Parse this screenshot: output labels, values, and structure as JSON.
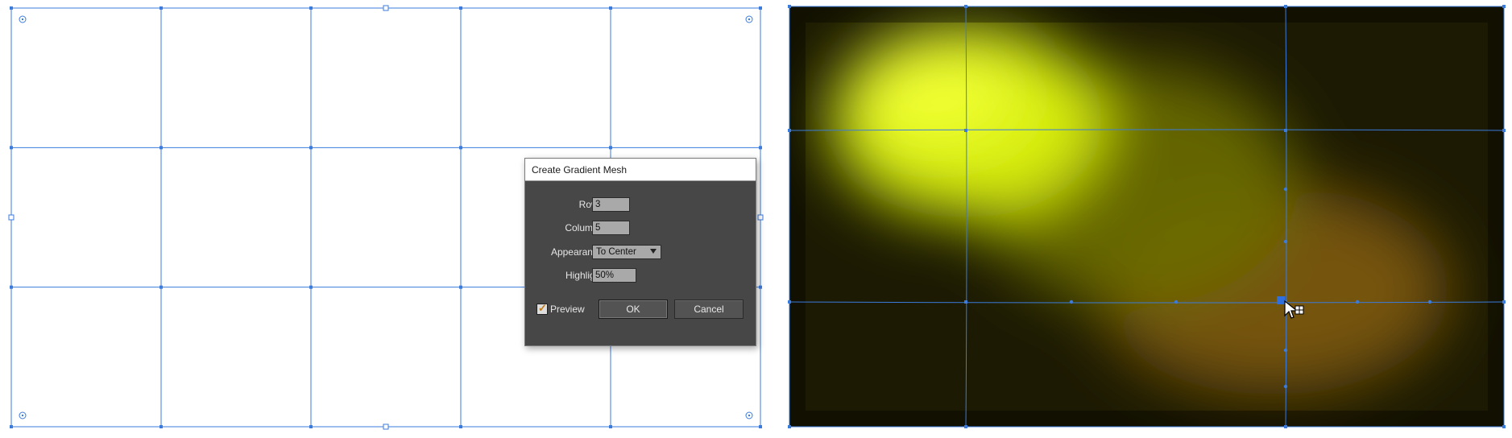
{
  "colors": {
    "mesh_line": "#3a7bdc",
    "dialog_bg": "#474747",
    "gradient_highlight": "#e8ff14",
    "gradient_mid": "#8a6a10",
    "gradient_dark": "#1a1a00"
  },
  "dialog": {
    "title": "Create Gradient Mesh",
    "rows_label": "Rows:",
    "rows_value": "3",
    "columns_label": "Columns:",
    "columns_value": "5",
    "appearance_label": "Appearance:",
    "appearance_value": "To Center",
    "highlight_label": "Highlight:",
    "highlight_value": "50%",
    "preview_label": "Preview",
    "preview_checked": true,
    "ok_label": "OK",
    "cancel_label": "Cancel"
  },
  "left_mesh": {
    "rows": 3,
    "columns": 5
  },
  "right_mesh": {
    "cursor_icon": "mesh-add-point-cursor-icon"
  }
}
